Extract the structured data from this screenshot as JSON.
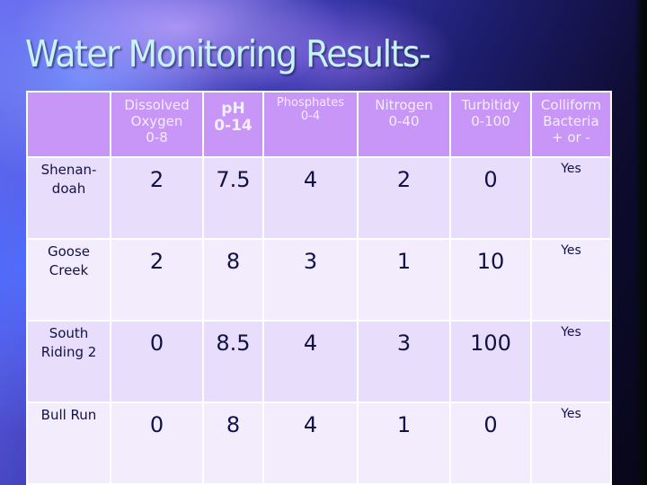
{
  "slide": {
    "title": "Water Monitoring Results-"
  },
  "table": {
    "headers": [
      "",
      "Dissolved\nOxygen\n0-8",
      "pH\n0-14",
      "Phosphates\n0-4",
      "Nitrogen\n0-40",
      "Turbitidy\n0-100",
      "Colliform\nBacteria\n+ or -"
    ],
    "rows": [
      {
        "site": "Shenan-\ndoah",
        "dissolved_oxygen": "2",
        "ph": "7.5",
        "phosphates": "4",
        "nitrogen": "2",
        "turbidity": "0",
        "coliform": "Yes"
      },
      {
        "site": "Goose\nCreek",
        "dissolved_oxygen": "2",
        "ph": "8",
        "phosphates": "3",
        "nitrogen": "1",
        "turbidity": "10",
        "coliform": "Yes"
      },
      {
        "site": "South\nRiding 2",
        "dissolved_oxygen": "0",
        "ph": "8.5",
        "phosphates": "4",
        "nitrogen": "3",
        "turbidity": "100",
        "coliform": "Yes"
      },
      {
        "site": "Bull Run",
        "dissolved_oxygen": "0",
        "ph": "8",
        "phosphates": "4",
        "nitrogen": "1",
        "turbidity": "0",
        "coliform": "Yes"
      }
    ]
  },
  "colors": {
    "header_bg": "#c896f6",
    "header_text": "#f4ecff",
    "row_odd_bg": "#e8defc",
    "row_even_bg": "#f2ecfd",
    "body_text": "#111248",
    "title_text": "#c8f4f8"
  }
}
